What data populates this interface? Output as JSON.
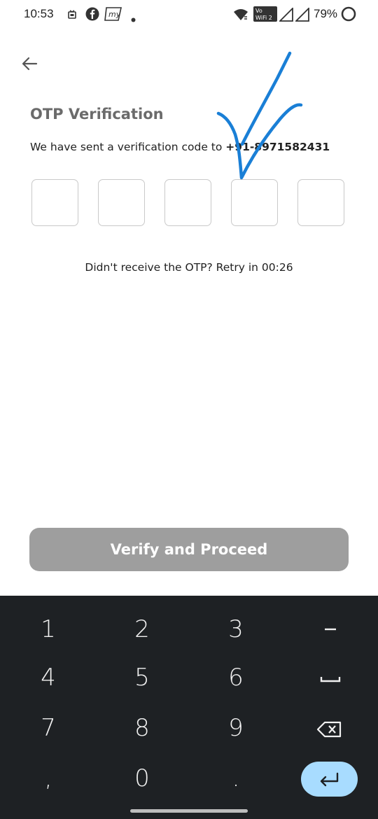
{
  "status_bar": {
    "time": "10:53",
    "battery": "79%",
    "wifi_label_top": "Vo",
    "wifi_label_bottom": "WiFi 2",
    "app_icon_label": "my"
  },
  "screen": {
    "title": "OTP Verification",
    "sent_text": "We have sent a verification code to ",
    "phone": "+91-8971582431",
    "otp_length": 5,
    "retry_text": "Didn't receive the OTP? Retry in 00:26",
    "verify_button": "Verify and Proceed"
  },
  "colors": {
    "verify_button_bg": "#9e9e9e",
    "keyboard_bg": "#1e2124",
    "enter_key_bg": "#a8dcff",
    "check_mark": "#1a7fd6"
  },
  "keyboard": {
    "keys": [
      "1",
      "2",
      "3",
      "4",
      "5",
      "6",
      "7",
      "8",
      "9",
      ",",
      "0",
      "."
    ],
    "icons": [
      "hyphen-icon",
      "space-icon",
      "backspace-icon",
      "enter-icon"
    ]
  }
}
